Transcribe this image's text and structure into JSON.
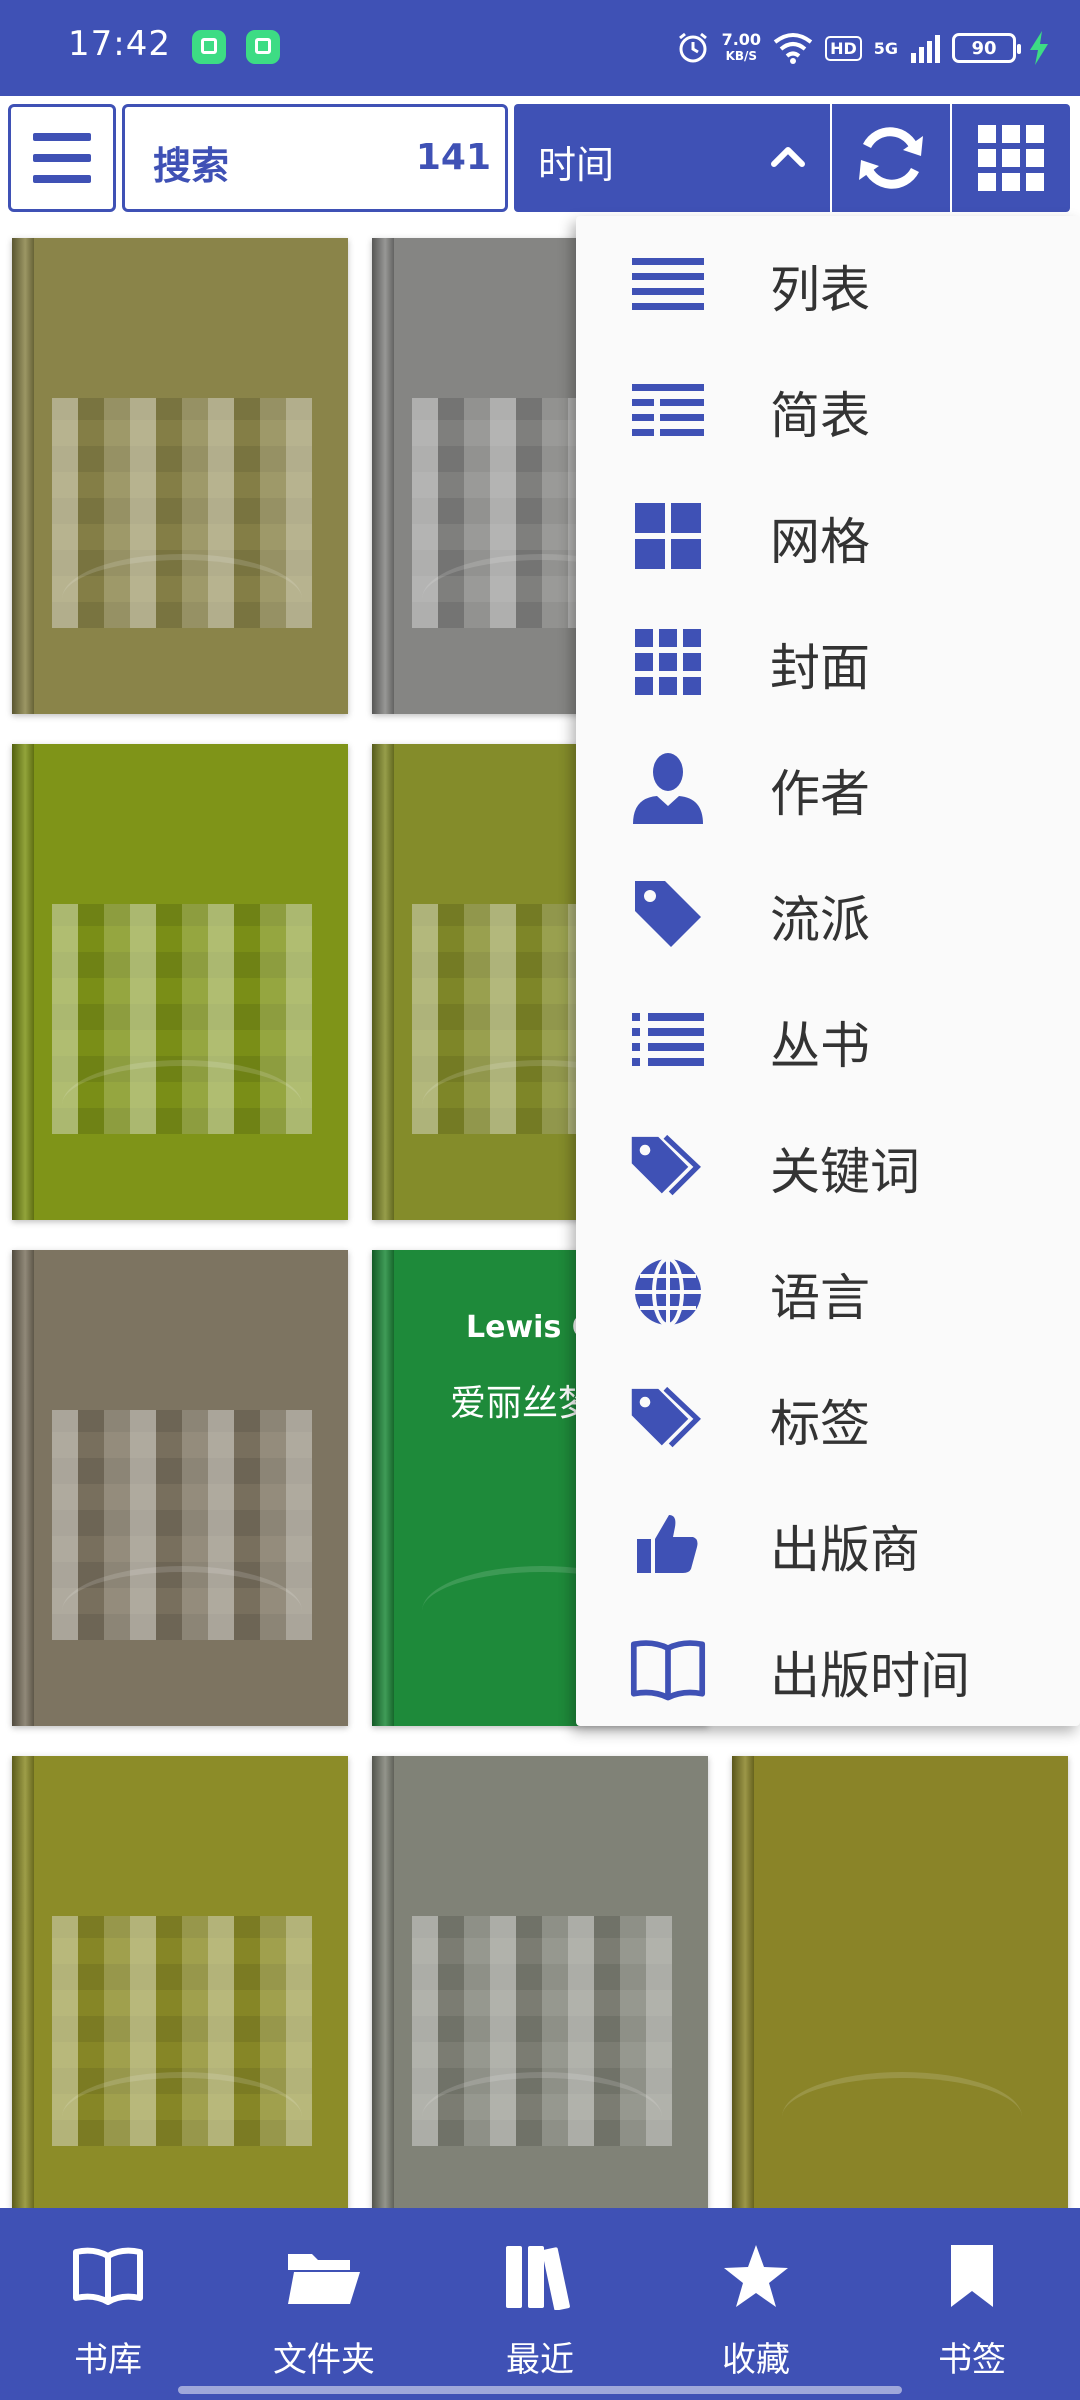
{
  "status_bar": {
    "time": "17:42",
    "net_speed_value": "7.00",
    "net_speed_unit": "KB/S",
    "hd": "HD",
    "signal": "5G",
    "battery": "90"
  },
  "toolbar": {
    "search_label": "搜索",
    "count": "141",
    "sort_label": "时间"
  },
  "books": [
    {
      "color": "#8a8449",
      "author": "",
      "title": ""
    },
    {
      "color": "#858583",
      "author": "",
      "title": ""
    },
    {
      "color": "#7f9418",
      "author": "",
      "title": ""
    },
    {
      "color": "#848c2a",
      "author": "",
      "title": ""
    },
    {
      "color": "#7d7461",
      "author": "",
      "title": ""
    },
    {
      "color": "#1e8a3a",
      "author": "Lewis Ca",
      "title": "爱丽丝梦境"
    },
    {
      "color": "#8c8c28",
      "author": "",
      "title": ""
    },
    {
      "color": "#808277",
      "author": "",
      "title": ""
    },
    {
      "color": "#8a8428",
      "author": "",
      "title": ""
    }
  ],
  "menu": {
    "items": [
      {
        "label": "列表",
        "icon": "list-lines-icon"
      },
      {
        "label": "简表",
        "icon": "compact-list-icon"
      },
      {
        "label": "网格",
        "icon": "grid-large-icon"
      },
      {
        "label": "封面",
        "icon": "grid-small-icon"
      },
      {
        "label": "作者",
        "icon": "person-icon"
      },
      {
        "label": "流派",
        "icon": "tag-icon"
      },
      {
        "label": "丛书",
        "icon": "bulleted-list-icon"
      },
      {
        "label": "关键词",
        "icon": "tags-icon"
      },
      {
        "label": "语言",
        "icon": "globe-icon"
      },
      {
        "label": "标签",
        "icon": "tags-icon"
      },
      {
        "label": "出版商",
        "icon": "thumbs-up-icon"
      },
      {
        "label": "出版时间",
        "icon": "open-book-icon"
      }
    ]
  },
  "bottom_nav": [
    {
      "label": "书库",
      "icon": "open-book-icon"
    },
    {
      "label": "文件夹",
      "icon": "folder-icon"
    },
    {
      "label": "最近",
      "icon": "books-shelf-icon"
    },
    {
      "label": "收藏",
      "icon": "star-icon"
    },
    {
      "label": "书签",
      "icon": "bookmark-icon"
    }
  ],
  "colors": {
    "primary": "#3f51b5",
    "menu_background": "#fafafa"
  }
}
